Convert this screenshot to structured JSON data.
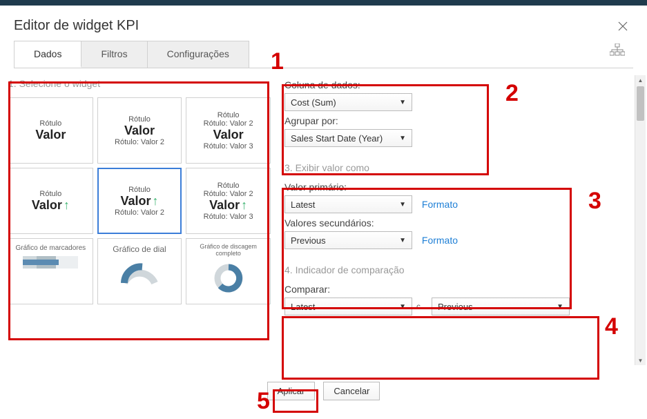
{
  "dialog": {
    "title": "Editor de widget KPI"
  },
  "tabs": {
    "dados": "Dados",
    "filtros": "Filtros",
    "config": "Configurações"
  },
  "step1": {
    "title": "1. Selecione o widget",
    "tiles": {
      "rotulo": "Rótulo",
      "valor": "Valor",
      "v2": "Rótulo: Valor 2",
      "v3": "Rótulo: Valor 3",
      "gbullet": "Gráfico de marcadores",
      "gdial": "Gráfico de dial",
      "gfull": "Gráfico de discagem completo"
    }
  },
  "step2": {
    "coluna_label": "Coluna de dados:",
    "coluna_value": "Cost (Sum)",
    "agrupar_label": "Agrupar por:",
    "agrupar_value": "Sales Start Date (Year)"
  },
  "step3": {
    "title": "3. Exibir valor como",
    "primary_label": "Valor primário:",
    "primary_value": "Latest",
    "secondary_label": "Valores secundários:",
    "secondary_value": "Previous",
    "format_link": "Formato"
  },
  "step4": {
    "title": "4. Indicador de comparação",
    "compare_label": "Comparar:",
    "left_value": "Latest",
    "mid_text": "c...",
    "right_value": "Previous"
  },
  "footer": {
    "apply": "Aplicar",
    "cancel": "Cancelar"
  },
  "annotations": {
    "n1": "1",
    "n2": "2",
    "n3": "3",
    "n4": "4",
    "n5": "5"
  }
}
